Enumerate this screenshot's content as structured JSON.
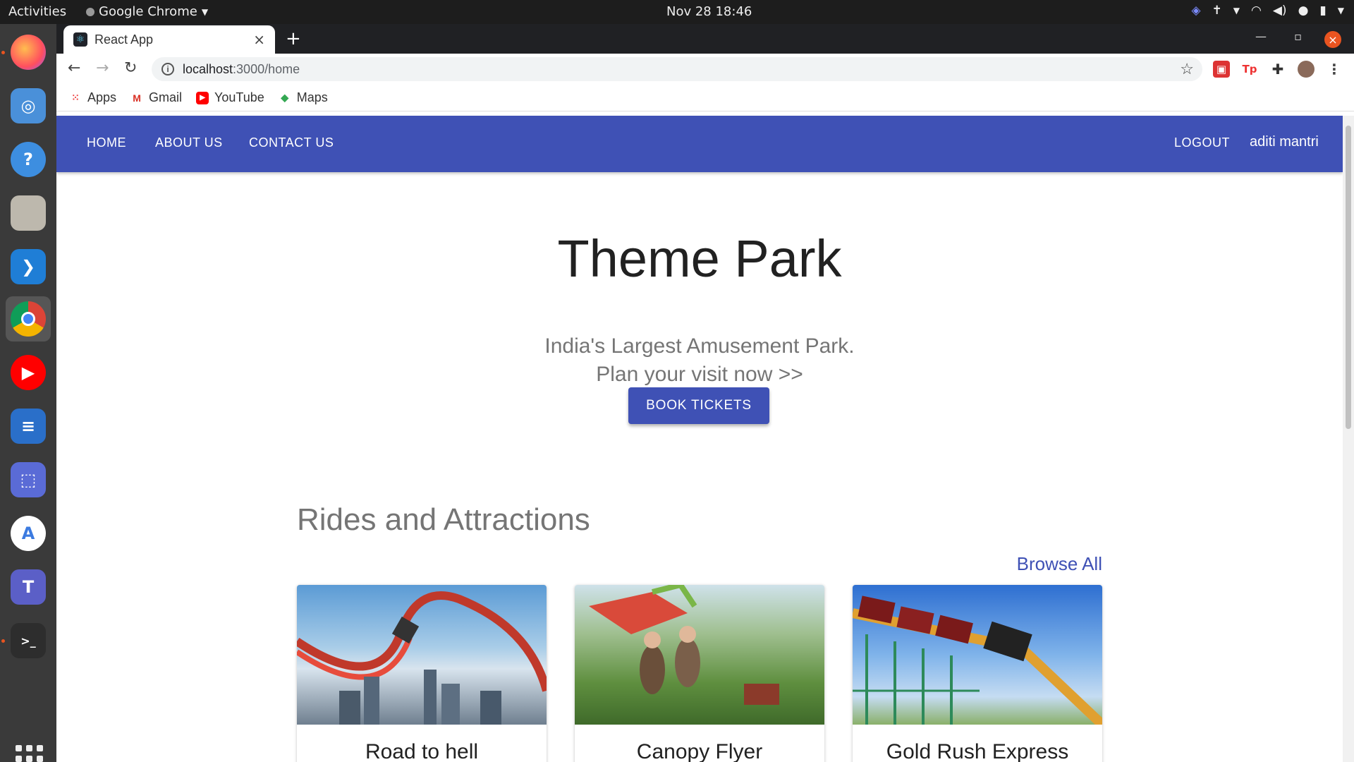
{
  "system": {
    "activities": "Activities",
    "app_name": "Google Chrome",
    "clock": "Nov 28  18:46"
  },
  "browser": {
    "tab_title": "React App",
    "url_host": "localhost",
    "url_path": ":3000/home",
    "bookmarks": [
      {
        "label": "Apps",
        "icon": "apps-grid-icon"
      },
      {
        "label": "Gmail",
        "icon": "gmail-icon"
      },
      {
        "label": "YouTube",
        "icon": "youtube-icon"
      },
      {
        "label": "Maps",
        "icon": "maps-icon"
      }
    ]
  },
  "nav": {
    "home": "HOME",
    "about": "ABOUT US",
    "contact": "CONTACT US",
    "logout": "LOGOUT",
    "user": "aditi mantri"
  },
  "hero": {
    "title": "Theme Park",
    "subtitle_line1": "India's Largest Amusement Park.",
    "subtitle_line2": "Plan your visit now >>",
    "cta": "BOOK TICKETS"
  },
  "rides": {
    "section_title": "Rides and Attractions",
    "browse_all": "Browse All",
    "items": [
      {
        "title": "Road to hell"
      },
      {
        "title": "Canopy Flyer"
      },
      {
        "title": "Gold Rush Express"
      }
    ]
  },
  "colors": {
    "primary": "#3f51b5",
    "topbar": "#1d1d1d",
    "dock": "#3a3a3a"
  }
}
